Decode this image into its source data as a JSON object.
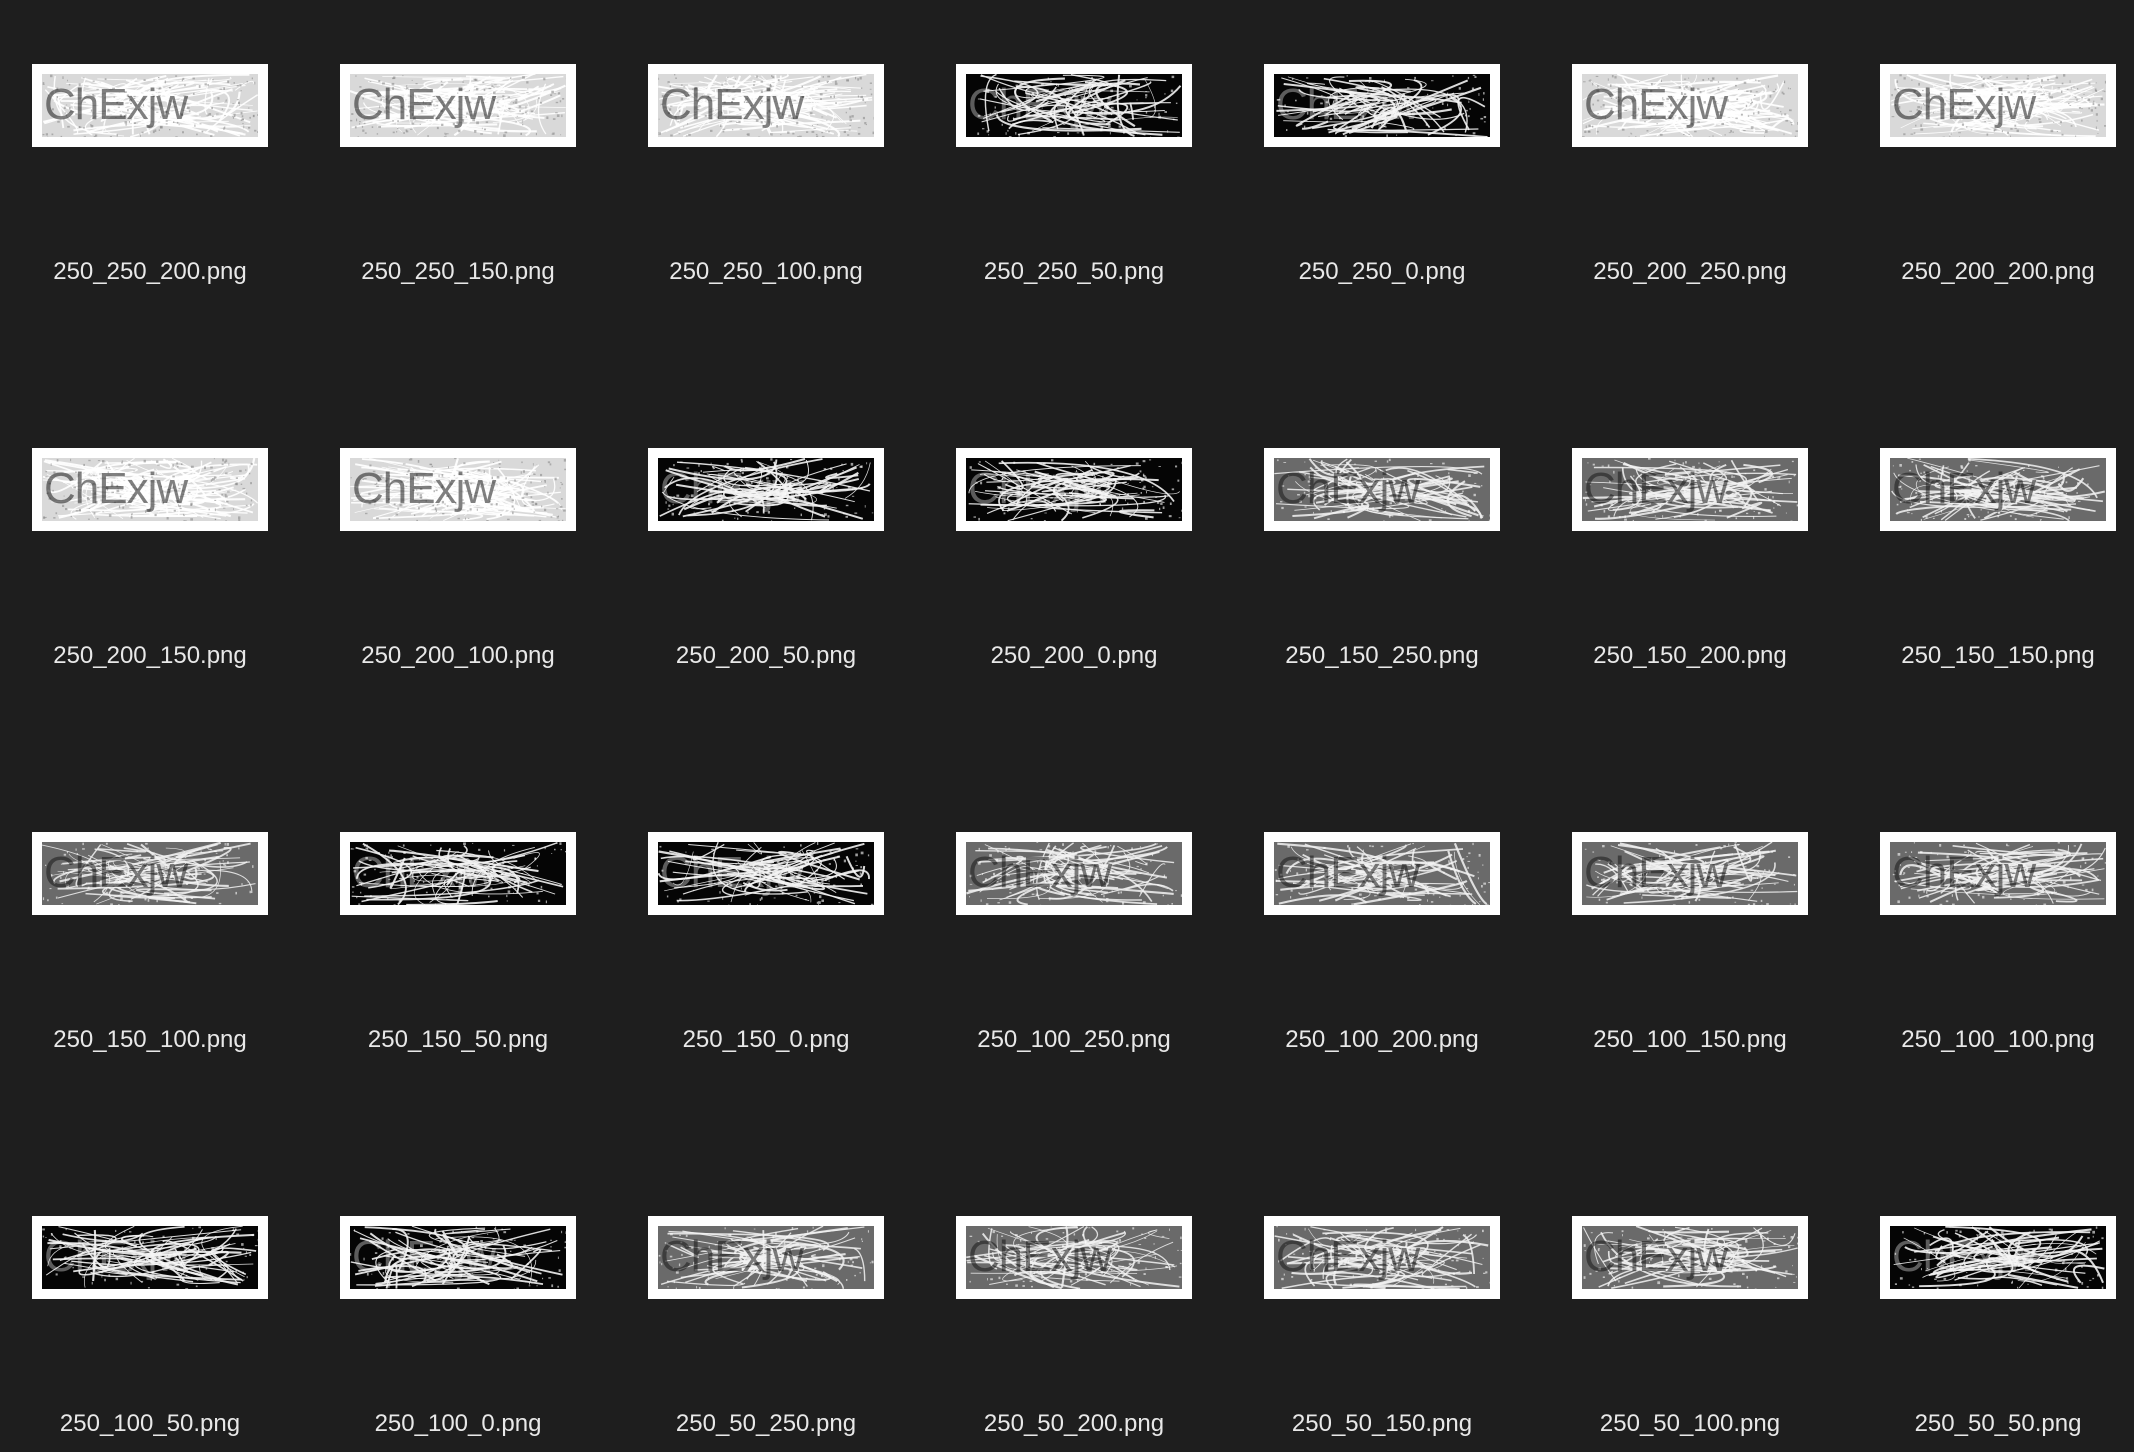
{
  "window": {
    "background": "#1e1e1e",
    "label_color": "#e8e8e8"
  },
  "files": [
    {
      "name": "250_250_200.png",
      "captcha_text": "ChExjw",
      "theme": "light"
    },
    {
      "name": "250_250_150.png",
      "captcha_text": "ChExjw",
      "theme": "light"
    },
    {
      "name": "250_250_100.png",
      "captcha_text": "ChExjw",
      "theme": "light"
    },
    {
      "name": "250_250_50.png",
      "captcha_text": "ChExjw",
      "theme": "dark"
    },
    {
      "name": "250_250_0.png",
      "captcha_text": "ChExjw",
      "theme": "dark"
    },
    {
      "name": "250_200_250.png",
      "captcha_text": "ChExjw",
      "theme": "light"
    },
    {
      "name": "250_200_200.png",
      "captcha_text": "ChExjw",
      "theme": "light"
    },
    {
      "name": "250_200_150.png",
      "captcha_text": "ChExjw",
      "theme": "light"
    },
    {
      "name": "250_200_100.png",
      "captcha_text": "ChExjw",
      "theme": "light"
    },
    {
      "name": "250_200_50.png",
      "captcha_text": "ChExjw",
      "theme": "dark"
    },
    {
      "name": "250_200_0.png",
      "captcha_text": "ChExjw",
      "theme": "dark"
    },
    {
      "name": "250_150_250.png",
      "captcha_text": "ChExjw",
      "theme": "mid"
    },
    {
      "name": "250_150_200.png",
      "captcha_text": "ChExjw",
      "theme": "mid"
    },
    {
      "name": "250_150_150.png",
      "captcha_text": "ChExjw",
      "theme": "mid"
    },
    {
      "name": "250_150_100.png",
      "captcha_text": "ChExjw",
      "theme": "mid"
    },
    {
      "name": "250_150_50.png",
      "captcha_text": "ChExjw",
      "theme": "dark"
    },
    {
      "name": "250_150_0.png",
      "captcha_text": "ChExjw",
      "theme": "dark"
    },
    {
      "name": "250_100_250.png",
      "captcha_text": "ChExjw",
      "theme": "mid"
    },
    {
      "name": "250_100_200.png",
      "captcha_text": "ChExjw",
      "theme": "mid"
    },
    {
      "name": "250_100_150.png",
      "captcha_text": "ChExjw",
      "theme": "mid"
    },
    {
      "name": "250_100_100.png",
      "captcha_text": "ChExjw",
      "theme": "mid"
    },
    {
      "name": "250_100_50.png",
      "captcha_text": "ChExjw",
      "theme": "dark"
    },
    {
      "name": "250_100_0.png",
      "captcha_text": "ChExjw",
      "theme": "dark"
    },
    {
      "name": "250_50_250.png",
      "captcha_text": "ChExjw",
      "theme": "mid"
    },
    {
      "name": "250_50_200.png",
      "captcha_text": "ChExjw",
      "theme": "mid"
    },
    {
      "name": "250_50_150.png",
      "captcha_text": "ChExjw",
      "theme": "mid"
    },
    {
      "name": "250_50_100.png",
      "captcha_text": "ChExjw",
      "theme": "mid"
    },
    {
      "name": "250_50_50.png",
      "captcha_text": "ChExjw",
      "theme": "dark"
    }
  ]
}
